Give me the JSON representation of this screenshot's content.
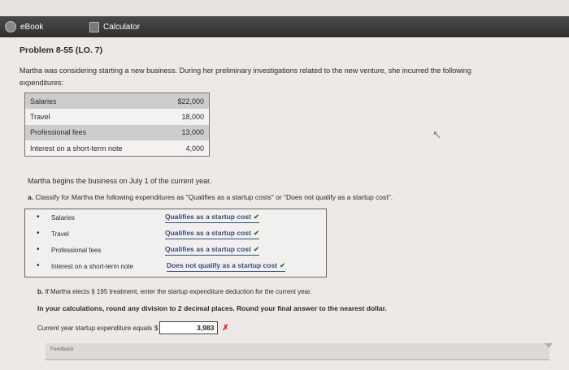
{
  "tabs": {
    "ebook": "eBook",
    "calculator": "Calculator"
  },
  "problem": {
    "title": "Problem 8-55 (LO. 7)",
    "intro": "Martha was considering starting a new business. During her preliminary investigations related to the new venture, she incurred the following expenditures:"
  },
  "expenditures": [
    {
      "label": "Salaries",
      "amount": "$22,000"
    },
    {
      "label": "Travel",
      "amount": "18,000"
    },
    {
      "label": "Professional fees",
      "amount": "13,000"
    },
    {
      "label": "Interest on a short-term note",
      "amount": "4,000"
    }
  ],
  "begins": "Martha begins the business on July 1 of the current year.",
  "part_a": {
    "prompt_letter": "a.",
    "prompt": "Classify for Martha the following expenditures as \"Qualifies as a startup costs\" or \"Does not qualify as a startup cost\".",
    "rows": [
      {
        "label": "Salaries",
        "answer": "Qualifies as a startup cost"
      },
      {
        "label": "Travel",
        "answer": "Qualifies as a startup cost"
      },
      {
        "label": "Professional fees",
        "answer": "Qualifies as a startup cost"
      },
      {
        "label": "Interest on a short-term note",
        "answer": "Does not qualify as a startup cost"
      }
    ]
  },
  "part_b": {
    "prompt_letter": "b.",
    "prompt": "If Martha elects § 195 treatment, enter the startup expenditure deduction for the current year.",
    "instructions": "In your calculations, round any division to 2 decimal places. Round your final answer to the nearest dollar.",
    "field_label": "Current year startup expenditure equals",
    "currency": "$",
    "value": "3,983"
  },
  "feedback": {
    "label": "Feedback"
  },
  "colors": {
    "correct": "#2d7a2d",
    "incorrect": "#d02020",
    "answer": "#3a4b7d"
  }
}
